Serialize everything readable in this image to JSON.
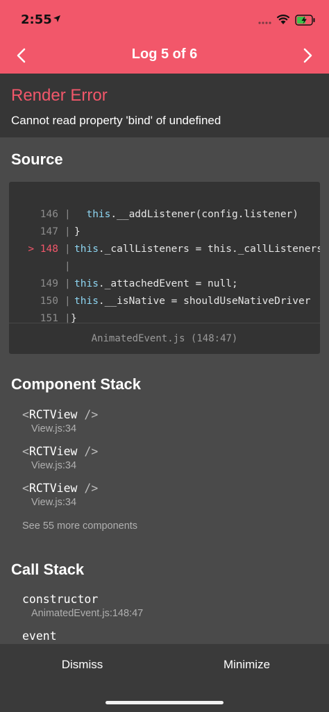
{
  "status_bar": {
    "time": "2:55",
    "icons": [
      "location-arrow-icon",
      "cellular-signal-icon",
      "wifi-icon",
      "battery-charging-icon"
    ]
  },
  "nav": {
    "title": "Log 5 of 6",
    "prev_icon": "chevron-left-icon",
    "next_icon": "chevron-right-icon"
  },
  "error": {
    "title": "Render Error",
    "message": "Cannot read property 'bind' of undefined"
  },
  "source": {
    "heading": "Source",
    "lines": [
      {
        "marker": "",
        "num": "146",
        "indent": "  ",
        "kw": "this",
        "rest": ".__addListener(config.listener)"
      },
      {
        "marker": "",
        "num": "147",
        "indent": "",
        "kw": "",
        "rest": "}"
      },
      {
        "marker": ">",
        "num": "148",
        "indent": "",
        "kw": "this",
        "rest": "._callListeners = this._callListeners"
      },
      {
        "marker": "",
        "num": "",
        "indent": "",
        "kw": "",
        "rest": ""
      },
      {
        "marker": "",
        "num": "149",
        "indent": "",
        "kw": "this",
        "rest": "._attachedEvent = null;"
      },
      {
        "marker": "",
        "num": "150",
        "indent": "",
        "kw": "this",
        "rest": ".__isNative = shouldUseNativeDriver"
      },
      {
        "marker": "",
        "num": "151",
        "indent": "",
        "kw": "",
        "rest": "}"
      }
    ],
    "file": "AnimatedEvent.js (148:47)"
  },
  "component_stack": {
    "heading": "Component Stack",
    "items": [
      {
        "open": "<",
        "name": "RCTView",
        "close": " />",
        "location": "View.js:34"
      },
      {
        "open": "<",
        "name": "RCTView",
        "close": " />",
        "location": "View.js:34"
      },
      {
        "open": "<",
        "name": "RCTView",
        "close": " />",
        "location": "View.js:34"
      }
    ],
    "more": "See 55 more components"
  },
  "call_stack": {
    "heading": "Call Stack",
    "items": [
      {
        "name": "constructor",
        "location": "AnimatedEvent.js:148:47"
      },
      {
        "name": "event",
        "location": ""
      }
    ]
  },
  "footer": {
    "dismiss_label": "Dismiss",
    "minimize_label": "Minimize"
  },
  "colors": {
    "accent": "#f2576a",
    "background": "#4a4a4a",
    "keyword": "#8ed6f2"
  }
}
